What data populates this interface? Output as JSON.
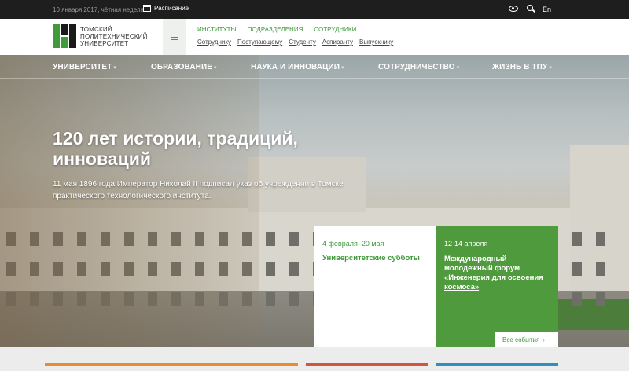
{
  "topbar": {
    "date": "10 января 2017, чётная неделя",
    "schedule": "Расписание",
    "lang": "En",
    "icons": [
      "calendar-icon",
      "eye-icon",
      "search-icon"
    ]
  },
  "header": {
    "logo_lines": [
      "ТОМСКИЙ",
      "ПОЛИТЕХНИЧЕСКИЙ",
      "УНИВЕРСИТЕТ"
    ],
    "top_links": [
      "ИНСТИТУТЫ",
      "ПОДРАЗДЕЛЕНИЯ",
      "СОТРУДНИКИ"
    ],
    "bottom_links": [
      "Сотруднику",
      "Поступающему",
      "Студенту",
      "Аспиранту",
      "Выпускнику"
    ]
  },
  "nav": {
    "items": [
      "УНИВЕРСИТЕТ",
      "ОБРАЗОВАНИЕ",
      "НАУКА И ИННОВАЦИИ",
      "СОТРУДНИЧЕСТВО",
      "ЖИЗНЬ В ТПУ"
    ]
  },
  "hero": {
    "title": "120 лет истории, традиций, инноваций",
    "description": "11 мая 1896 года Император Николай II подписал указ об учреждении в Томске практического технологического института."
  },
  "events": [
    {
      "date": "4 февраля–20 мая",
      "title": "Университетские субботы"
    },
    {
      "date": "12-14 апреля",
      "title_prefix": "Международный молодежный форум",
      "title_link": "«Инженерия для освоения космоса»"
    }
  ],
  "all_events_label": "Все события",
  "colors": {
    "brand_green": "#3f9a3a",
    "card_green": "#4e9a3d",
    "topbar": "#1e1e1e"
  }
}
